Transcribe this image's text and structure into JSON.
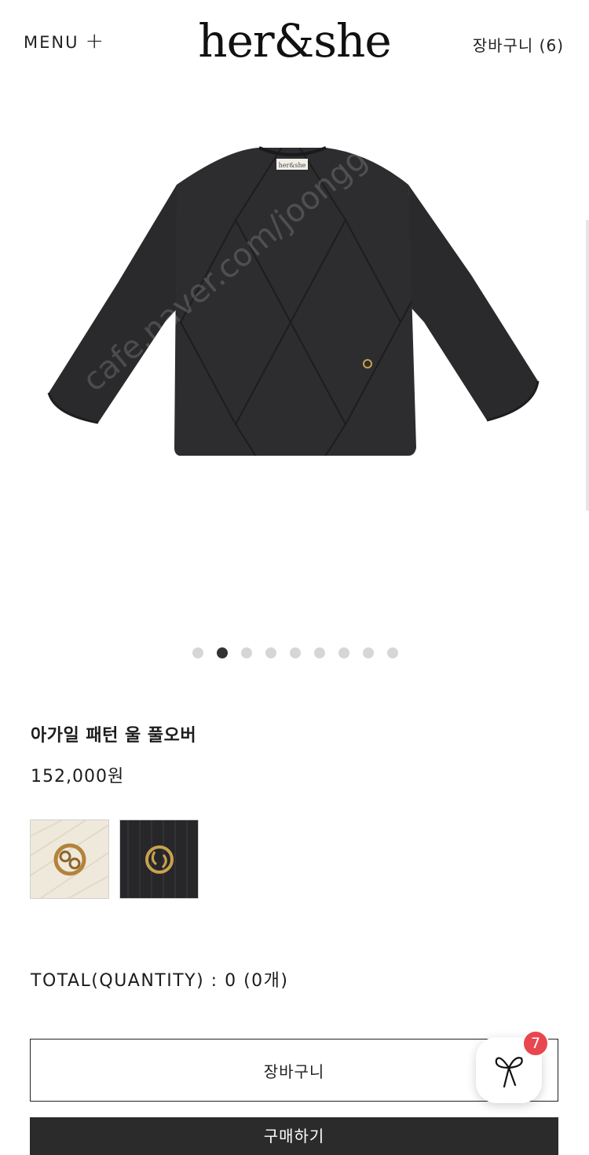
{
  "header": {
    "menu_label": "MENU",
    "menu_icon": "+",
    "logo": "her&she",
    "cart_label": "장바구니 (6)"
  },
  "gallery": {
    "slide_count": 9,
    "active_index": 1,
    "garment_label": "her&she",
    "watermark": "cafe.naver.com/joonggonara"
  },
  "product": {
    "name": "아가일 패턴 울 풀오버",
    "price": "152,000원",
    "swatches": [
      {
        "name": "ivory",
        "color": "#efe9dc",
        "emblem_color": "#b3833a"
      },
      {
        "name": "black",
        "color": "#27272a",
        "emblem_color": "#caa24c"
      }
    ],
    "total": "TOTAL(QUANTITY) : 0 (0개)"
  },
  "actions": {
    "cart_button": "장바구니",
    "buy_button": "구매하기"
  },
  "chat": {
    "badge_count": "7",
    "icon": "ribbon-icon"
  },
  "colors": {
    "sweater": "#2a2a2d",
    "dot_active": "#333333",
    "dot_inactive": "#d6d6d6",
    "badge": "#e8474f",
    "buy_button": "#2b2b2b"
  }
}
